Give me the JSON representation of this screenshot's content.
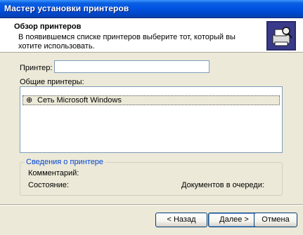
{
  "window": {
    "title": "Мастер установки принтеров"
  },
  "header": {
    "title": "Обзор принтеров",
    "subtitle": "В появившемся списке принтеров выберите тот, который вы хотите использовать.",
    "icon": "printer-search-icon"
  },
  "form": {
    "printer_label": "Принтер:",
    "printer_value": "",
    "shared_label": "Общие принтеры:",
    "shared_items": [
      {
        "label": "Сеть Microsoft Windows",
        "icon": "network-icon"
      }
    ]
  },
  "details": {
    "legend": "Сведения о принтере",
    "comment_label": "Комментарий:",
    "status_label": "Состояние:",
    "documents_label": "Документов в очереди:"
  },
  "buttons": {
    "back": "< Назад",
    "next": "Далее >",
    "cancel": "Отмена"
  }
}
